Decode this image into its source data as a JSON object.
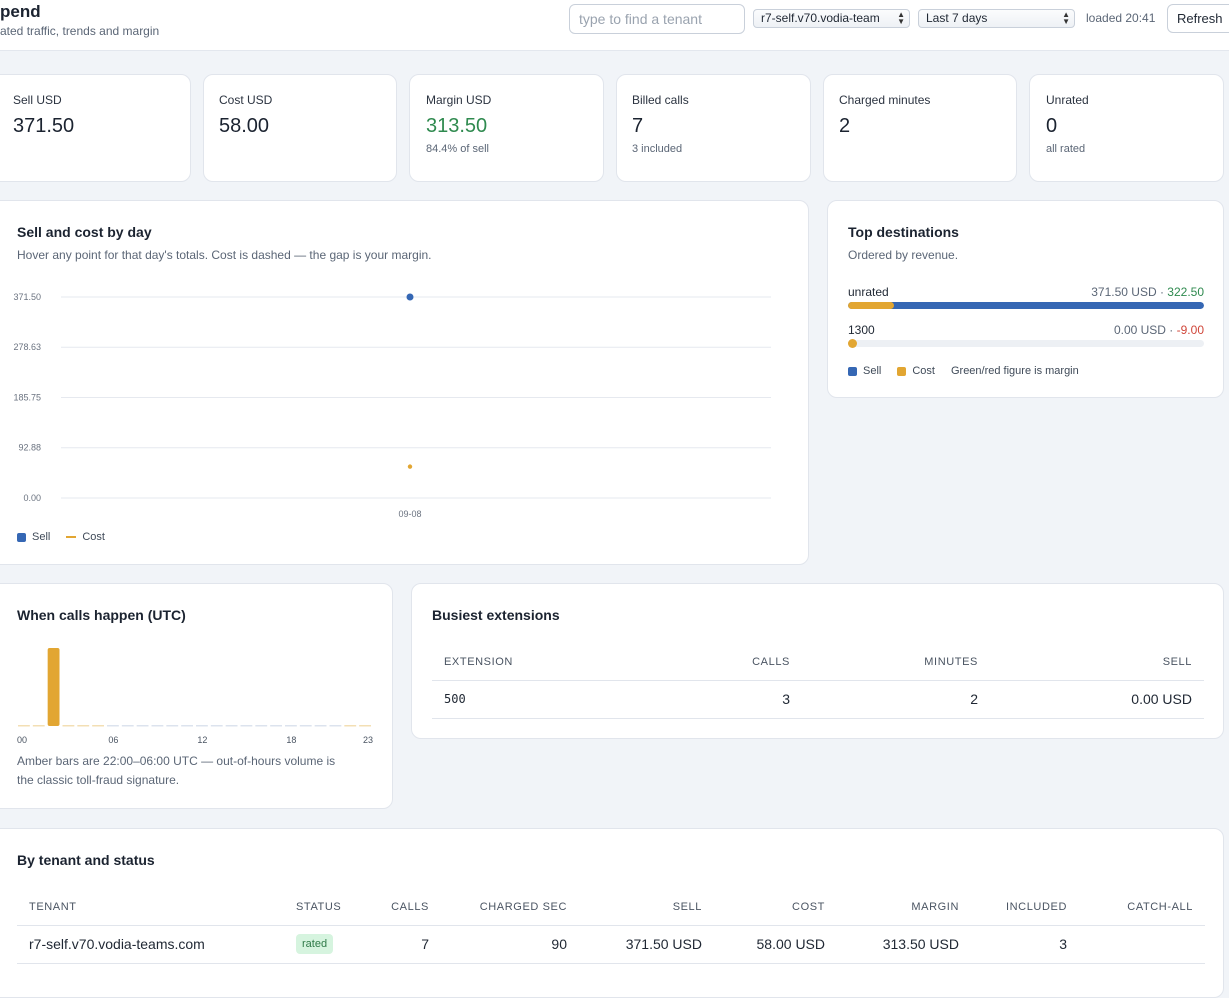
{
  "header": {
    "title": "pend",
    "subtitle": "ated traffic, trends and margin",
    "search_placeholder": "type to find a tenant",
    "tenant_select": "r7-self.v70.vodia-team",
    "range_select": "Last 7 days",
    "loaded": "loaded 20:41",
    "refresh_label": "Refresh"
  },
  "stats": [
    {
      "label": "Sell USD",
      "value": "371.50",
      "sub": ""
    },
    {
      "label": "Cost USD",
      "value": "58.00",
      "sub": ""
    },
    {
      "label": "Margin USD",
      "value": "313.50",
      "sub": "84.4% of sell"
    },
    {
      "label": "Billed calls",
      "value": "7",
      "sub": "3 included"
    },
    {
      "label": "Charged minutes",
      "value": "2",
      "sub": ""
    },
    {
      "label": "Unrated",
      "value": "0",
      "sub": "all rated"
    }
  ],
  "daily_chart": {
    "title": "Sell and cost by day",
    "description": "Hover any point for that day's totals. Cost is dashed — the gap is your margin.",
    "legend_sell": "Sell",
    "legend_cost": "Cost",
    "sell_color": "#3567b4",
    "cost_color": "#e2a632"
  },
  "chart_data": {
    "type": "line",
    "x": [
      "09-08"
    ],
    "series": [
      {
        "name": "Sell",
        "values": [
          371.5
        ]
      },
      {
        "name": "Cost",
        "values": [
          58.0
        ]
      }
    ],
    "yticks": [
      "0.00",
      "92.88",
      "185.75",
      "278.63",
      "371.50"
    ],
    "ylim": [
      0,
      371.5
    ],
    "grid": true,
    "legend": "bottom-left"
  },
  "destinations": {
    "title": "Top destinations",
    "description": "Ordered by revenue.",
    "rows": [
      {
        "name": "unrated",
        "sell_text": "371.50 USD",
        "margin_text": "322.50",
        "margin_sign": "pos",
        "sell_frac": 1.0,
        "cost_frac": 0.13
      },
      {
        "name": "1300",
        "sell_text": "0.00 USD",
        "margin_text": "-9.00",
        "margin_sign": "neg",
        "sell_frac": 0.0,
        "cost_frac": 0.0
      }
    ],
    "legend_sell": "Sell",
    "legend_cost": "Cost",
    "legend_note": "Green/red figure is margin"
  },
  "hours": {
    "title": "When calls happen (UTC)",
    "values": [
      0,
      0,
      1,
      0,
      0,
      0,
      0,
      0,
      0,
      0,
      0,
      0,
      0,
      0,
      0,
      0,
      0,
      0,
      0,
      0,
      0,
      0,
      0,
      0
    ],
    "labels": [
      "00",
      "06",
      "12",
      "18",
      "23"
    ],
    "note_line1": "Amber bars are 22:00–06:00 UTC — out-of-hours volume is",
    "note_line2": "the classic toll-fraud signature."
  },
  "extensions": {
    "title": "Busiest extensions",
    "columns": [
      "Extension",
      "Calls",
      "Minutes",
      "Sell"
    ],
    "rows": [
      {
        "extension": "500",
        "calls": "3",
        "minutes": "2",
        "sell": "0.00 USD"
      }
    ]
  },
  "tenants": {
    "title": "By tenant and status",
    "columns": [
      "Tenant",
      "Status",
      "Calls",
      "Charged sec",
      "Sell",
      "Cost",
      "Margin",
      "Included",
      "Catch-all"
    ],
    "rows": [
      {
        "tenant": "r7-self.v70.vodia-teams.com",
        "status": "rated",
        "calls": "7",
        "charged_sec": "90",
        "sell": "371.50 USD",
        "cost": "58.00 USD",
        "margin": "313.50 USD",
        "included": "3",
        "catch_all": ""
      }
    ]
  }
}
